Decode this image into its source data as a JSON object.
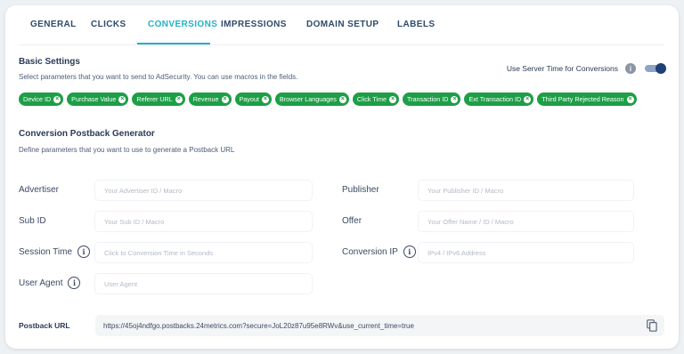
{
  "tabs": [
    "GENERAL",
    "CLICKS",
    "CONVERSIONS",
    "IMPRESSIONS",
    "DOMAIN SETUP",
    "LABELS"
  ],
  "active_tab": "CONVERSIONS",
  "basic_settings": {
    "title": "Basic Settings",
    "description": "Select parameters that you want to send to AdSecurity. You can use macros in the fields.",
    "server_time_label": "Use Server Time for Conversions",
    "server_time_enabled": true,
    "chips": [
      "Device ID",
      "Purchase Value",
      "Referer URL",
      "Revenue",
      "Payout",
      "Browser Languages",
      "Click Time",
      "Transaction ID",
      "Ext Transaction ID",
      "Third Party Rejected Reason"
    ]
  },
  "generator": {
    "title": "Conversion Postback Generator",
    "description": "Define parameters that you want to use to generate a Postback URL",
    "fields": {
      "advertiser": {
        "label": "Advertiser",
        "placeholder": "Your Advertiser ID / Macro"
      },
      "publisher": {
        "label": "Publisher",
        "placeholder": "Your Publisher ID / Macro"
      },
      "sub_id": {
        "label": "Sub ID",
        "placeholder": "Your Sub ID / Macro"
      },
      "offer": {
        "label": "Offer",
        "placeholder": "Your Offer Name / ID / Macro"
      },
      "session_time": {
        "label": "Session Time",
        "placeholder": "Click to Conversion Time in Seconds"
      },
      "conversion_ip": {
        "label": "Conversion IP",
        "placeholder": "IPv4 / IPv6 Address"
      },
      "user_agent": {
        "label": "User Agent",
        "placeholder": "User Agent"
      }
    },
    "postback_label": "Postback URL",
    "postback_url": "https://45oj4ndfgo.postbacks.24metrics.com?secure=JoL20z87u95e8RWv&use_current_time=true"
  },
  "colors": {
    "accent": "#22b3c8",
    "chip": "#1e9e47",
    "toggle": "#1f3f77"
  },
  "icons": {
    "info": "info-icon",
    "copy": "copy-icon",
    "chip_remove": "close-circle-icon"
  }
}
